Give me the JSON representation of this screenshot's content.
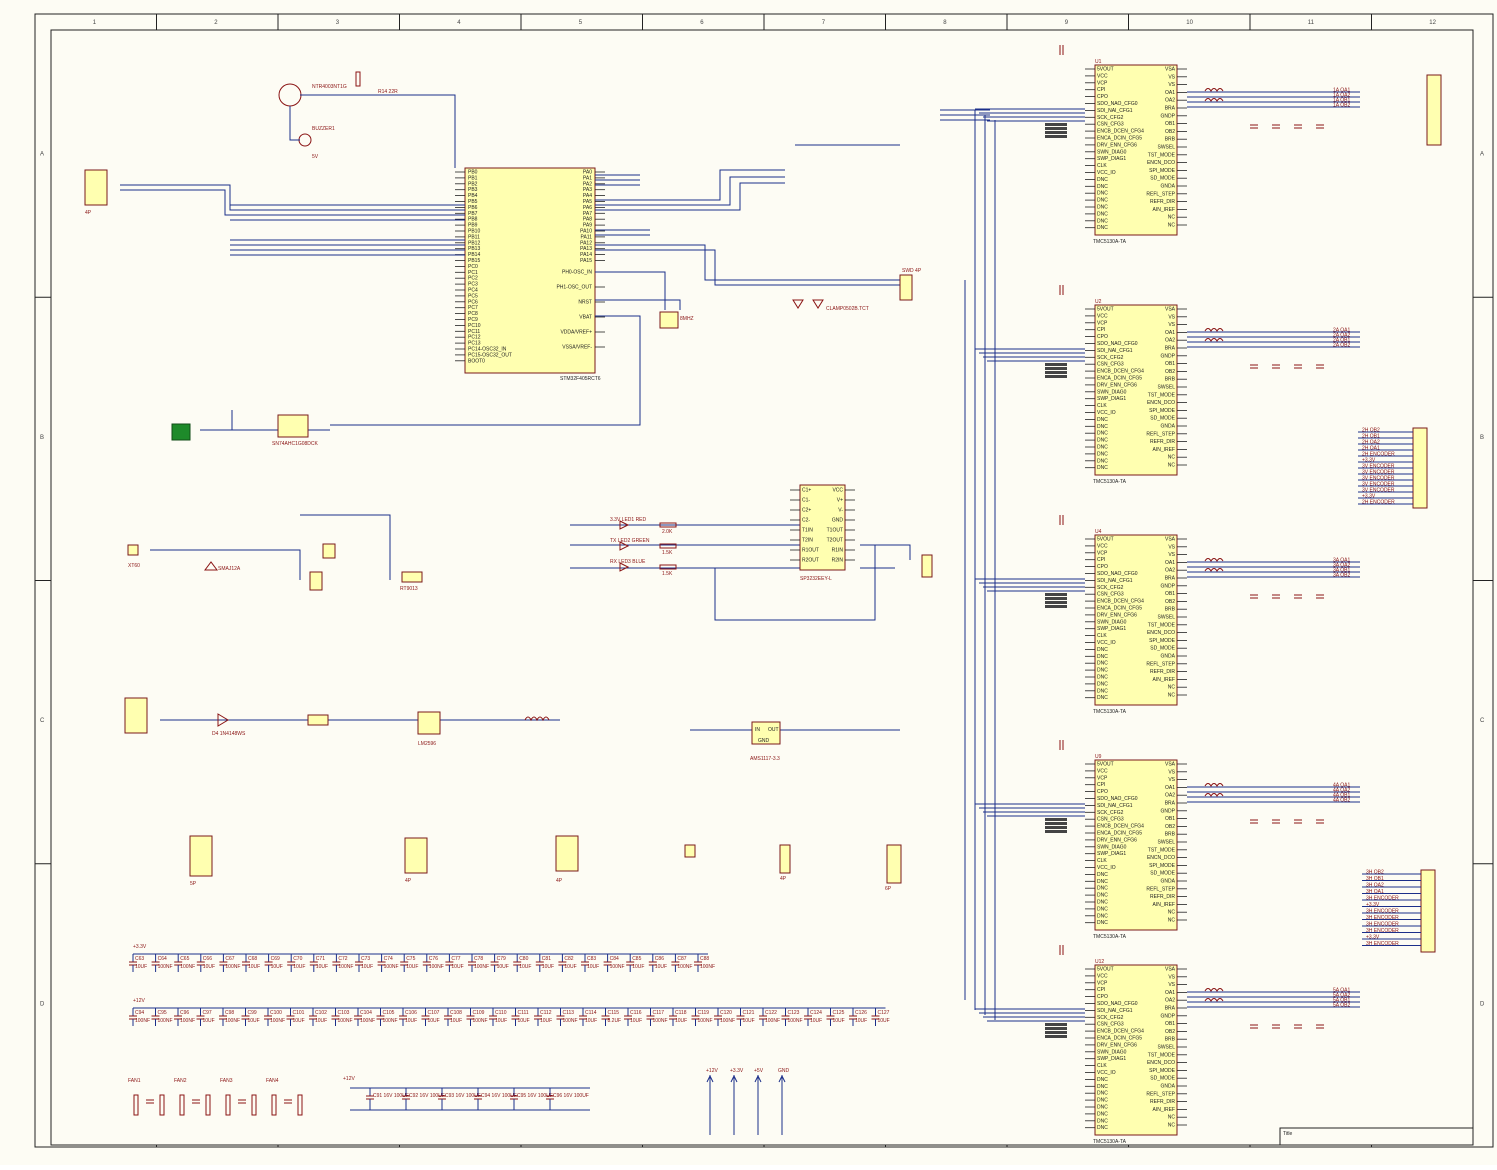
{
  "zones": {
    "columns": [
      "1",
      "2",
      "3",
      "4",
      "5",
      "6",
      "7",
      "8",
      "9",
      "10",
      "11",
      "12"
    ],
    "rows": [
      "A",
      "B",
      "C",
      "D"
    ]
  },
  "mcu": {
    "ref": "U1",
    "part": "STM32F405RCT6",
    "left_pins": [
      "PB0",
      "PB1",
      "PB2",
      "PB3",
      "PB4",
      "PB5",
      "PB6",
      "PB7",
      "PB8",
      "PB9",
      "PB10",
      "PB11",
      "PB12",
      "PB13",
      "PB14",
      "PB15",
      "PC0",
      "PC1",
      "PC2",
      "PC3",
      "PC4",
      "PC5",
      "PC6",
      "PC7",
      "PC8",
      "PC9",
      "PC10",
      "PC11",
      "PC12",
      "PC13",
      "PC14-OSC32_IN",
      "PC15-OSC32_OUT",
      "BOOT0"
    ],
    "right_pins": [
      "PA0",
      "PA1",
      "PA2",
      "PA3",
      "PA4",
      "PA5",
      "PA6",
      "PA7",
      "PA8",
      "PA9",
      "PA10",
      "PA11",
      "PA12",
      "PA13",
      "PA14",
      "PA15",
      "PH0-OSC_IN",
      "PH1-OSC_OUT",
      "NRST",
      "VBAT",
      "VDDA/VREF+",
      "VSSA/VREF-"
    ],
    "top_pins": [
      "VDD",
      "VDD",
      "VDD",
      "VDD"
    ],
    "bottom_pins": [
      "VSS",
      "VSS",
      "VSS",
      "VSS"
    ]
  },
  "driver": {
    "part": "TMC5130A-TA",
    "refs": [
      "U1",
      "U2",
      "U4",
      "U9",
      "U12"
    ],
    "left_pins": [
      "5VOUT",
      "VCC",
      "VCP",
      "CPI",
      "CPO",
      "SDO_NAO_CFG0",
      "SDI_NAI_CFG1",
      "SCK_CFG2",
      "CSN_CFG3",
      "ENCB_DCEN_CFG4",
      "ENCA_DCIN_CFG5",
      "DRV_ENN_CFG6",
      "SWN_DIAG0",
      "SWP_DIAG1",
      "CLK",
      "VCC_IO",
      "DNC",
      "DNC",
      "DNC",
      "DNC",
      "DNC",
      "DNC",
      "DNC",
      "DNC"
    ],
    "right_pins": [
      "VSA",
      "VS",
      "VS",
      "OA1",
      "OA2",
      "BRA",
      "GNDP",
      "OB1",
      "OB2",
      "BRB",
      "SWSEL",
      "TST_MODE",
      "ENCN_DCO",
      "SPI_MODE",
      "SD_MODE",
      "GNDA",
      "REFL_STEP",
      "REFR_DIR",
      "AIN_IREF",
      "NC",
      "NC"
    ]
  },
  "net_labels": {
    "mcu": [
      "TMC ENCODER",
      "TMC ENCODER",
      "TMC ENCODER",
      "CAN_SERIAL1",
      "CAN_SERIAL2",
      "I2C SDA",
      "FAN",
      "PA10",
      "TMC CS FOR",
      "PA15",
      "PA9",
      "2U GDIAN",
      "3U ENCODER",
      "5V_LINUX",
      "TX_LINUX",
      "RX_LINUX",
      "2U GDIAN"
    ],
    "driver_outputs": [
      "1A OA1",
      "1A OA2",
      "1A OB1",
      "1A OB2",
      "2A OA1",
      "2A OA2",
      "2A OB1",
      "2A OB2",
      "3A OA1",
      "3A OA2",
      "3A OB1",
      "3A OB2",
      "4A OA1",
      "4A OA2",
      "4A OB1",
      "4A OB2",
      "5A OA1",
      "5A OA2",
      "5A OB1",
      "5A OB2"
    ],
    "right_connector_1": [
      "2H OB2",
      "2H OB1",
      "2H OA2",
      "2H OA1",
      "2H ENCODER",
      "+3.3V",
      "3V ENCODER",
      "3V ENCODER",
      "3V ENCODER",
      "3V ENCODER",
      "3V ENCODER",
      "+3.3V",
      "2H ENCODER"
    ],
    "right_connector_2": [
      "3H OB2",
      "3H OB1",
      "3H OA2",
      "3H OA1",
      "3H ENCODER",
      "+3.3V",
      "3H ENCODER",
      "3H ENCODER",
      "3H ENCODER",
      "3H ENCODER",
      "+3.3V",
      "3H ENCODER"
    ]
  },
  "components": {
    "q1": {
      "ref": "Q1",
      "part": "NTR4003NT1G",
      "label": "BAS16"
    },
    "buzzer": {
      "ref": "BUZZER1",
      "label": "5V"
    },
    "r14": "R14 22R",
    "r16": "R16 10K",
    "c_top": [
      "C1 100NF",
      "C2 100NF"
    ],
    "p_header": "4P",
    "crystal": {
      "ref": "X1",
      "label": "8MHZ"
    },
    "clamp": "CLAMP0502B.TCT",
    "swd": "SWD 4P",
    "pwr_sw": "SW1 3P",
    "opto": "SN74AHC1G08DCK",
    "logic_level": "SN74AHC1G08DCK",
    "max": {
      "ref": "U6",
      "part": "SP3232EEY-L",
      "left": [
        "C1+",
        "C1-",
        "C2+",
        "C2-",
        "T1IN",
        "T2IN",
        "R1OUT",
        "R2OUT"
      ],
      "right": [
        "VCC",
        "V+",
        "V-",
        "GND",
        "T1OUT",
        "T2OUT",
        "R1IN",
        "R2IN"
      ]
    },
    "leds": [
      "3.3V LED1 RED",
      "TX LED2 GREEN",
      "RX LED3 BLUE"
    ],
    "led_res": [
      "2.0K",
      "1.5K",
      "1.5K"
    ],
    "ams": {
      "ref": "U7",
      "part": "AMS1117-3.3",
      "pins": [
        "IN",
        "OUT",
        "GND"
      ]
    },
    "power_in": {
      "ref": "J1",
      "label": "XT60"
    },
    "lm": {
      "ref": "U8",
      "label": "LM2596"
    },
    "diode": "D4 1N4148WS",
    "fuse": "F1 SMD",
    "ldo_label": "RT9013",
    "eswitch": "ESW",
    "tvs": "SMAJ12A",
    "inductor": "L1 10UH",
    "connector_4p": "4P",
    "connector_5p": "5P",
    "connector_6p": "6P"
  },
  "cap_row_1": {
    "rail": "+3.3V",
    "items": [
      "C63 10UF",
      "C64 100NF",
      "C65 100NF",
      "C66 10UF",
      "C67 100NF",
      "C68 10UF",
      "C69 10UF",
      "C70 10UF",
      "C71 10UF",
      "C72 100NF",
      "C73 10UF",
      "C74 100NF",
      "C75 10UF",
      "C76 100NF",
      "C77 10UF",
      "C78 100NF",
      "C79 10UF",
      "C80 10UF",
      "C81 10UF",
      "C82 10UF",
      "C83 10UF",
      "C84 100NF",
      "C85 10UF",
      "C86 10UF",
      "C87 100NF",
      "C88 100NF"
    ]
  },
  "cap_row_2": {
    "rail": "+12V",
    "items": [
      "C94 100NF",
      "C95 100NF",
      "C96 100NF",
      "C97 10UF",
      "C98 100NF",
      "C99 10UF",
      "C100 100NF",
      "C101 10UF",
      "C102 10UF",
      "C103 100NF",
      "C104 100NF",
      "C105 100NF",
      "C106 10UF",
      "C107 10UF",
      "C108 10UF",
      "C109 100NF",
      "C110 10UF",
      "C111 10UF",
      "C112 10UF",
      "C113 100NF",
      "C114 10UF",
      "C115 8.2UF",
      "C116 10UF",
      "C117 100NF",
      "C118 10UF",
      "C119 100NF",
      "C120 100NF",
      "C121 10UF",
      "C122 100NF",
      "C123 100NF",
      "C124 10UF",
      "C125 10UF",
      "C126 10UF",
      "C127 10UF"
    ]
  },
  "bulk_caps": [
    "C91 16V 100UF",
    "C92 16V 100UF",
    "C93 16V 100UF",
    "C94 16V 100UF",
    "C95 16V 100UF",
    "C96 16V 100UF"
  ],
  "fan_labels": [
    "FAN1",
    "FAN2",
    "FAN3",
    "FAN4"
  ],
  "power_flags": [
    "+12V",
    "+3.3V",
    "+5V",
    "GND"
  ],
  "title_block": "Title"
}
